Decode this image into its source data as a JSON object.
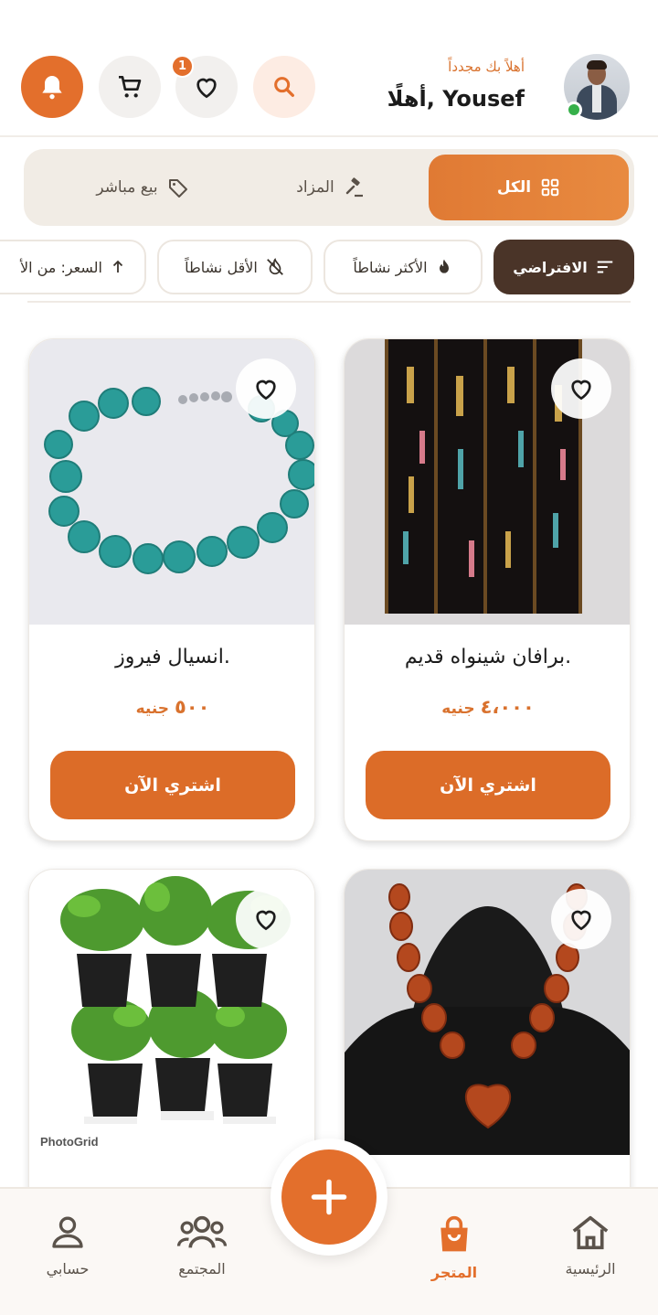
{
  "header": {
    "greeting_small": "أهلاً بك مجدداً",
    "greeting_big": "أهلًا, Yousef",
    "favorites_count": "1",
    "icons": [
      "search-icon",
      "heart-icon",
      "cart-icon",
      "bell-icon"
    ],
    "accent_color": "#e36f2c"
  },
  "tabs": [
    {
      "label": "الكل",
      "icon": "grid-icon",
      "active": true
    },
    {
      "label": "المزاد",
      "icon": "gavel-icon",
      "active": false
    },
    {
      "label": "بيع مباشر",
      "icon": "tag-icon",
      "active": false
    }
  ],
  "filters": [
    {
      "label": "الافتراضي",
      "icon": "sort-icon",
      "active": true
    },
    {
      "label": "الأكثر نشاطاً",
      "icon": "flame-icon",
      "active": false
    },
    {
      "label": "الأقل نشاطاً",
      "icon": "flame-off-icon",
      "active": false
    },
    {
      "label": "السعر: من الأ",
      "icon": "arrow-up-icon",
      "active": false
    }
  ],
  "products": [
    {
      "title": "برافان شينواه قديم.",
      "price": "٤،٠٠٠",
      "currency": "جنيه",
      "buy_label": "اشتري الآن"
    },
    {
      "title": "انسيال فيروز.",
      "price": "٥٠٠",
      "currency": "جنيه",
      "buy_label": "اشتري الآن"
    },
    {
      "title": "",
      "price": "",
      "currency": "",
      "buy_label": ""
    },
    {
      "title": "",
      "price": "",
      "currency": "",
      "buy_label": "",
      "image_caption": "PhotoGrid"
    }
  ],
  "bottom_nav": [
    {
      "label": "الرئيسية",
      "icon": "home-icon",
      "active": false
    },
    {
      "label": "المتجر",
      "icon": "shopping-bag-icon",
      "active": true
    },
    {
      "label": "المجتمع",
      "icon": "community-icon",
      "active": false
    },
    {
      "label": "حسابي",
      "icon": "user-icon",
      "active": false
    }
  ],
  "fab_icon": "plus-icon"
}
